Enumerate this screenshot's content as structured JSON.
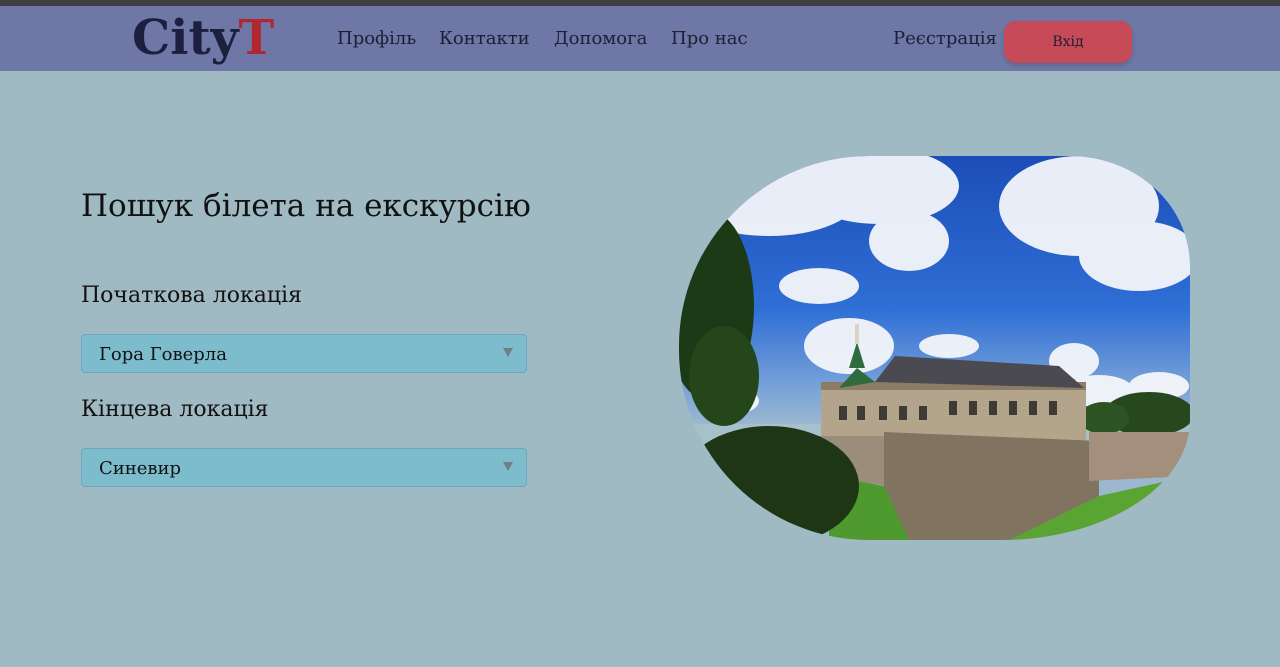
{
  "logo": {
    "main": "City",
    "accent": "T"
  },
  "nav": {
    "links": [
      "Профіль",
      "Контакти",
      "Допомога",
      "Про нас"
    ],
    "register_label": "Реєстрація",
    "login_label": "Вхід"
  },
  "search": {
    "title": "Пошук білета на екскурсію",
    "start_label": "Початкова локація",
    "start_value": "Гора Говерла",
    "end_label": "Кінцева локація",
    "end_value": "Синевир"
  },
  "colors": {
    "background": "#a0bac3",
    "navbar": "#6e77a5",
    "login_button": "#c64a58",
    "select": "#7cbccc",
    "logo_accent": "#b0272f"
  }
}
